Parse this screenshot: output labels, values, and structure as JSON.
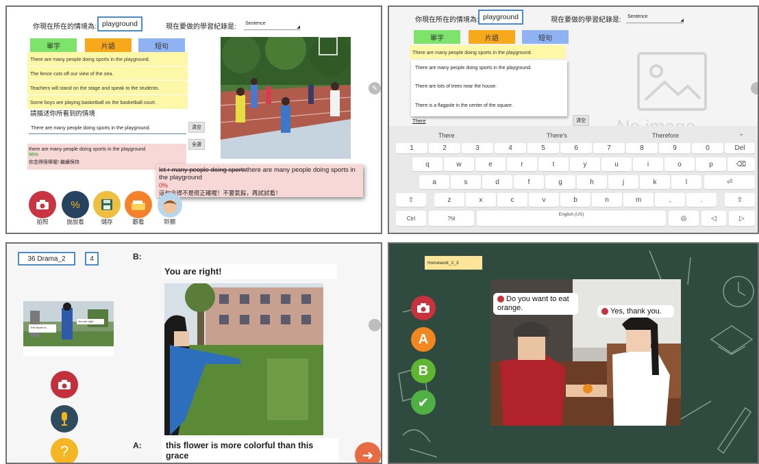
{
  "panel1": {
    "context_label": "你現在所在的情境為:",
    "context_value": "playground",
    "record_label": "現在要做的學習紀錄是:",
    "record_value": "Sentence",
    "tabs": [
      "單字",
      "片語",
      "短句"
    ],
    "sentences": [
      "There are many people doing sports in the playground.",
      "The fence cuts off our view of the sea.",
      "Teachers will stand on the stage and speak to the students.",
      "Some boys are playing basketball on the basketball court."
    ],
    "describe_prompt": "請描述你所看到的情境",
    "input_value": "There are many people doing sports in the playground.",
    "clear_label": "清空",
    "all_label": "全選",
    "result_text": "there are many people doing sports in the playground",
    "result_score": "96%",
    "result_feedback": "你念得很棒喔! 繼續保持",
    "popup_strike": "let r many people doing sports",
    "popup_text": "there are many people doing sports in the playground",
    "popup_score": "0%",
    "popup_feedback": "這句念得不是很正確喔！不要氣餒，再試試看！",
    "tools": [
      "拍照",
      "說說看",
      "儲存",
      "觀看",
      "聆聽"
    ]
  },
  "panel2": {
    "context_label": "你現在所在的情境為:",
    "context_value": "playground",
    "record_label": "現在要做的學習紀錄是:",
    "record_value": "Sentence",
    "tabs": [
      "單字",
      "片語",
      "短句"
    ],
    "highlight_sentence": "There are many people doing sports in the playground.",
    "dropdown_items": [
      "There are many people doing sports in the playground.",
      "There are lots of trees near the house.",
      "There is a flagpole in the center of the square."
    ],
    "input_value": "There",
    "clear_label": "清空",
    "placeholder_text": "No image",
    "suggestions": [
      "There",
      "There's",
      "Therefore"
    ],
    "row1": [
      "1",
      "2",
      "3",
      "4",
      "5",
      "6",
      "7",
      "8",
      "9",
      "0",
      "Del"
    ],
    "row2": [
      "q",
      "w",
      "e",
      "r",
      "t",
      "y",
      "u",
      "i",
      "o",
      "p"
    ],
    "row3": [
      "a",
      "s",
      "d",
      "f",
      "g",
      "h",
      "j",
      "k",
      "l"
    ],
    "row4": [
      "z",
      "x",
      "c",
      "v",
      "b",
      "n",
      "m",
      ",",
      ".",
      "!"
    ],
    "ctrl_label": "Ctrl",
    "lang_label": "English (US)"
  },
  "panel3": {
    "title": "36 Drama_2",
    "page": "4",
    "label_b": "B:",
    "label_a": "A:",
    "b_text": "You are right!",
    "a_text": "this flower is more colorful than this grace",
    "thumb_left_label": "This flower is ...",
    "thumb_right_label": "You are right"
  },
  "panel4": {
    "title": "Homework_2_3",
    "bubble1": "Do you want to eat orange.",
    "bubble2": "Yes, thank you.",
    "side_a": "A",
    "side_b": "B"
  },
  "colors": {
    "green_tab": "#7ee36b",
    "orange_tab": "#f7a81b",
    "blue_tab": "#8fb2f3",
    "sentence_bg": "#fdf7a8",
    "pink_bg": "#f8d7d7",
    "red_button": "#d13a3a",
    "chalkboard": "#2f4a3f"
  }
}
